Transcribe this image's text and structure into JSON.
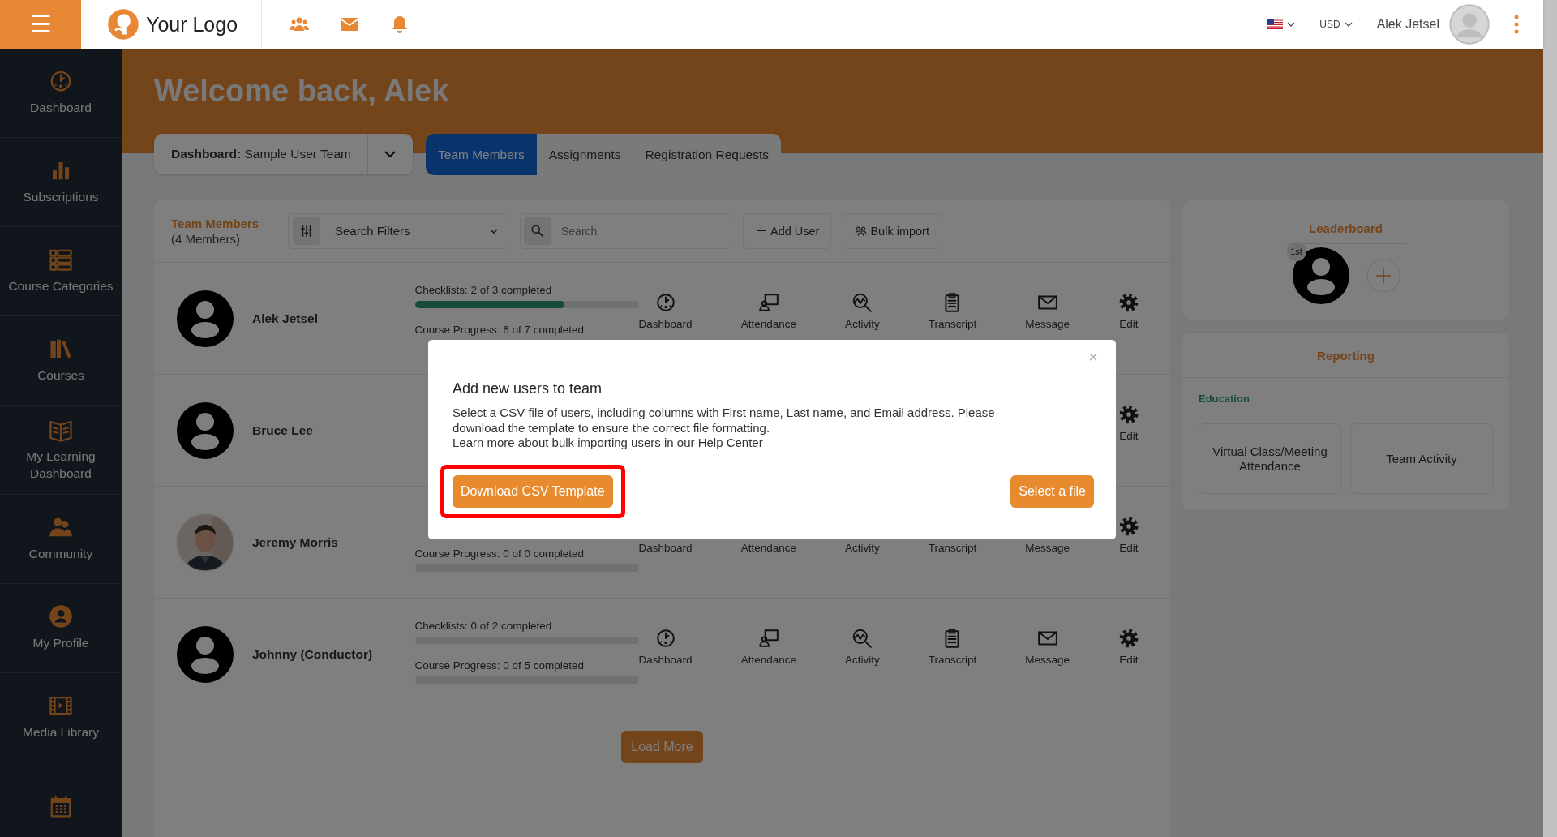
{
  "topbar": {
    "menu_glyph": "☰",
    "logo_text": "Your Logo",
    "currency": "USD",
    "user_name": "Alek Jetsel"
  },
  "sidebar": {
    "items": [
      {
        "kind": "dashboard",
        "label": "Dashboard"
      },
      {
        "kind": "subscriptions",
        "label": "Subscriptions"
      },
      {
        "kind": "categories",
        "label": "Course Categories"
      },
      {
        "kind": "courses",
        "label": "Courses"
      },
      {
        "kind": "learning",
        "label": "My Learning Dashboard"
      },
      {
        "kind": "community",
        "label": "Community"
      },
      {
        "kind": "profile",
        "label": "My Profile"
      },
      {
        "kind": "media",
        "label": "Media Library"
      },
      {
        "kind": "calendar"
      }
    ]
  },
  "header": {
    "title": "Welcome back, Alek"
  },
  "team_selector": {
    "label": "Dashboard:",
    "value": "Sample User Team"
  },
  "tabs": [
    {
      "label": "Team Members",
      "selected": true
    },
    {
      "label": "Assignments",
      "selected": false
    },
    {
      "label": "Registration Requests",
      "selected": false
    }
  ],
  "members_panel": {
    "title": "Team Members",
    "count": "(4 Members)",
    "filter": {
      "value": "Search Filters"
    },
    "search": {
      "placeholder": "Search"
    },
    "buttons": [
      {
        "kind": "add",
        "label": "Add User"
      },
      {
        "kind": "import",
        "label": "Bulk import"
      }
    ],
    "rows": [
      {
        "name": "Alek Jetsel",
        "avatar": {
          "kind": "default"
        },
        "checklist": {
          "text": "Checklists: 2 of 3 completed",
          "level": 0.67
        },
        "progress": {
          "text": "Course Progress: 6 of 7 completed"
        },
        "actions": [
          {
            "kind": "dashboard",
            "label": "Dashboard"
          },
          {
            "kind": "attendance",
            "label": "Attendance"
          },
          {
            "kind": "activity",
            "label": "Activity"
          },
          {
            "kind": "transcript",
            "label": "Transcript"
          },
          {
            "kind": "message",
            "label": "Message"
          },
          {
            "kind": "edit",
            "label": "Edit"
          }
        ]
      },
      {
        "name": "Bruce Lee",
        "avatar": {
          "kind": "default"
        },
        "actions": [
          {
            "kind": "edit",
            "label": "Edit"
          }
        ]
      },
      {
        "name": "Jeremy Morris",
        "progress": {
          "text": "Course Progress: 0 of 0 completed",
          "level": 0
        },
        "actions": [
          {
            "kind": "covered",
            "label": "Dashboard"
          },
          {
            "kind": "covered",
            "label": "Attendance"
          },
          {
            "kind": "covered",
            "label": "Activity"
          },
          {
            "kind": "covered",
            "label": "Transcript"
          },
          {
            "kind": "covered",
            "label": "Message"
          },
          {
            "kind": "edit",
            "label": "Edit"
          }
        ]
      },
      {
        "name": "Johnny (Conductor)",
        "avatar": {
          "kind": "default"
        },
        "checklist": {
          "text": "Checklists: 0 of 2 completed",
          "level": 0
        },
        "progress": {
          "text": "Course Progress: 0 of 5 completed",
          "level": 0
        },
        "actions": [
          {
            "kind": "dashboard",
            "label": "Dashboard"
          },
          {
            "kind": "attendance",
            "label": "Attendance"
          },
          {
            "kind": "activity",
            "label": "Activity"
          },
          {
            "kind": "transcript",
            "label": "Transcript"
          },
          {
            "kind": "message",
            "label": "Message"
          },
          {
            "kind": "edit",
            "label": "Edit"
          }
        ]
      }
    ],
    "load_more": "Load More"
  },
  "leaderboard": {
    "title": "Leaderboard",
    "entries": [
      {
        "rank": "1st"
      }
    ]
  },
  "reporting": {
    "title": "Reporting",
    "section": "Education",
    "tiles": [
      "Virtual Class/Meeting Attendance",
      "Team Activity"
    ]
  },
  "modal": {
    "close_glyph": "×",
    "title": "Add new users to team",
    "paragraphs": [
      "Select a CSV file of users, including columns with First name, Last name, and Email address. Please download the template to ensure the correct file formatting.",
      "Learn more about bulk importing users in our Help Center"
    ],
    "buttons": [
      {
        "label": "Download CSV Template",
        "highlighted": true
      },
      {
        "label": "Select a file",
        "highlighted": false
      }
    ]
  }
}
